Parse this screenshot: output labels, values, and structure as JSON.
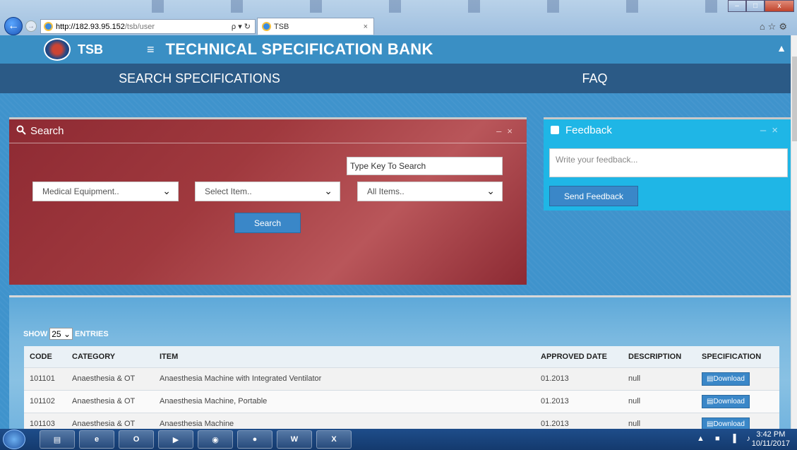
{
  "browser": {
    "url_host": "http://182.93.95.152",
    "url_path": "/tsb/user",
    "addr_tools": "ρ ▾ ↻",
    "tab_title": "TSB",
    "tab_close": "×",
    "back": "←",
    "forward": "→",
    "win_min": "–",
    "win_max": "□",
    "win_close": "x",
    "fav_icons": "⌂☆⚙"
  },
  "header": {
    "brand": "TSB",
    "menu_icon": "≡",
    "title": "TECHNICAL SPECIFICATION BANK",
    "user_icon": "▲"
  },
  "nav": {
    "items": [
      "SEARCH SPECIFICATIONS",
      "FAQ"
    ]
  },
  "search": {
    "title": "Search",
    "panel_controls": "–×",
    "keyword_value": "Type Key To Search",
    "selects": [
      "Medical Equipment..",
      "Select Item..",
      "All Items.."
    ],
    "chevron": "⌄",
    "button": "Search"
  },
  "feedback": {
    "title": "Feedback",
    "panel_controls": "–×",
    "placeholder": "Write your feedback...",
    "button": "Send Feedback"
  },
  "table": {
    "show_label": "SHOW",
    "page_length": "25",
    "entries_label": "ENTRIES",
    "columns": [
      "CODE",
      "CATEGORY",
      "ITEM",
      "APPROVED DATE",
      "DESCRIPTION",
      "SPECIFICATION"
    ],
    "rows": [
      {
        "code": "101101",
        "category": "Anaesthesia & OT",
        "item": "Anaesthesia Machine with Integrated Ventilator",
        "approved": "01.2013",
        "description": "null",
        "spec": "Download"
      },
      {
        "code": "101102",
        "category": "Anaesthesia & OT",
        "item": "Anaesthesia Machine, Portable",
        "approved": "01.2013",
        "description": "null",
        "spec": "Download"
      },
      {
        "code": "101103",
        "category": "Anaesthesia & OT",
        "item": "Anaesthesia Machine",
        "approved": "01.2013",
        "description": "null",
        "spec": "Download"
      }
    ]
  },
  "taskbar": {
    "apps": [
      "e",
      "O",
      "W",
      "X"
    ],
    "tray": "▲ ■ ▐ ♪",
    "time": "3:42 PM",
    "date": "10/11/2017"
  }
}
